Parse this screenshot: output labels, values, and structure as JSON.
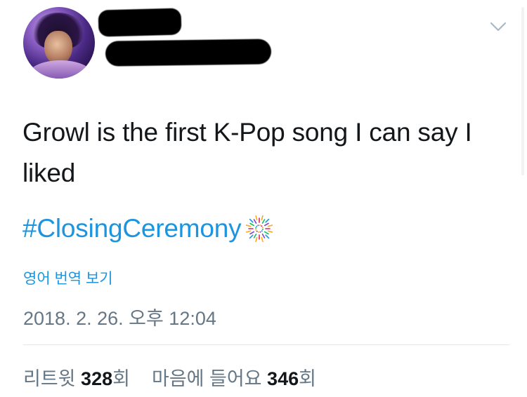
{
  "tweet": {
    "text": "Growl is the first K-Pop song I can say I liked",
    "hashtag": "#ClosingCeremony",
    "hashflag_icon": "fireworks-icon",
    "translate_label": "영어 번역 보기",
    "timestamp": "2018. 2. 26. 오후 12:04",
    "retweets_label": "리트윗",
    "retweets_count": "328",
    "retweets_unit": "회",
    "likes_label": "마음에 들어요",
    "likes_count": "346",
    "likes_unit": "회"
  },
  "icons": {
    "menu": "chevron-down-icon",
    "avatar": "avatar"
  },
  "colors": {
    "link": "#1b95e0",
    "text": "#14171a",
    "secondary": "#657786",
    "divider": "#e1e8ed"
  }
}
